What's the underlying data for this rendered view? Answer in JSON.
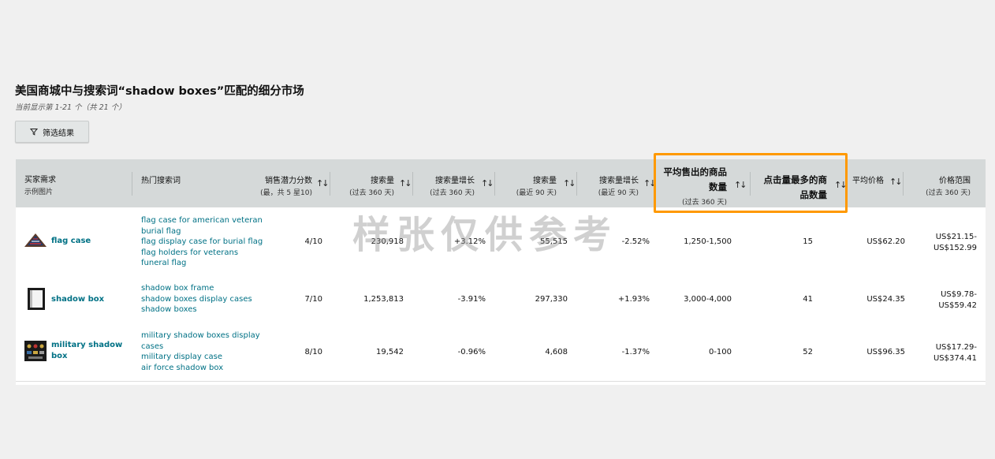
{
  "header": {
    "title": "美国商城中与搜索词“shadow boxes”匹配的细分市场",
    "subtitle": "当前显示第 1-21 个（共 21 个）",
    "filter_label": "筛选结果"
  },
  "table": {
    "columns": {
      "need": {
        "line1": "买家需求",
        "line2": "示例图片"
      },
      "keywords": {
        "line1": "热门搜索词"
      },
      "potential": {
        "line1": "销售潜力分数",
        "line2": "(最，共 5 星10)"
      },
      "volume360": {
        "line1": "搜索量",
        "line2": "(过去 360 天)"
      },
      "growth360": {
        "line1": "搜索量增长",
        "line2": "(过去 360 天)"
      },
      "volume90": {
        "line1": "搜索量",
        "line2": "(最近 90 天)"
      },
      "growth90": {
        "line1": "搜索量增长",
        "line2": "(最近 90 天)"
      },
      "units_sold": {
        "line1": "平均售出的商品",
        "line2": "数量",
        "line3": "(过去 360 天)"
      },
      "top_clicked": {
        "line1": "点击量最多的商",
        "line2": "品数量"
      },
      "avg_price": {
        "line1": "平均价格"
      },
      "price_range": {
        "line1": "价格范围",
        "line2": "(过去 360 天)"
      }
    },
    "sort_icon": "↑↓",
    "rows": [
      {
        "need": "flag case",
        "thumb_icon": "flag-case-icon",
        "keywords": [
          "flag case for american veteran",
          "burial flag",
          "flag display case for burial flag",
          "flag holders for veterans",
          "funeral flag"
        ],
        "potential": "4/10",
        "volume360": "230,918",
        "growth360": "+3.12%",
        "volume90": "55,515",
        "growth90": "-2.52%",
        "units_sold": "1,250-1,500",
        "top_clicked": "15",
        "avg_price": "US$62.20",
        "price_min": "US$21.15-",
        "price_max": "US$152.99"
      },
      {
        "need": "shadow box",
        "thumb_icon": "shadow-box-icon",
        "keywords": [
          "shadow box frame",
          "shadow boxes display cases",
          "shadow boxes"
        ],
        "potential": "7/10",
        "volume360": "1,253,813",
        "growth360": "-3.91%",
        "volume90": "297,330",
        "growth90": "+1.93%",
        "units_sold": "3,000-4,000",
        "top_clicked": "41",
        "avg_price": "US$24.35",
        "price_min": "US$9.78-",
        "price_max": "US$59.42"
      },
      {
        "need_line1": "military shadow",
        "need_line2": "box",
        "thumb_icon": "military-shadow-box-icon",
        "keywords": [
          "military shadow boxes display",
          "cases",
          "military display case",
          "air force shadow box"
        ],
        "potential": "8/10",
        "volume360": "19,542",
        "growth360": "-0.96%",
        "volume90": "4,608",
        "growth90": "-1.37%",
        "units_sold": "0-100",
        "top_clicked": "52",
        "avg_price": "US$96.35",
        "price_min": "US$17.29-",
        "price_max": "US$374.41"
      }
    ]
  },
  "watermark": "样张仅供参考",
  "colors": {
    "accent_link": "#007185",
    "highlight": "#ff9900",
    "header_bg": "#d5d9d9"
  }
}
